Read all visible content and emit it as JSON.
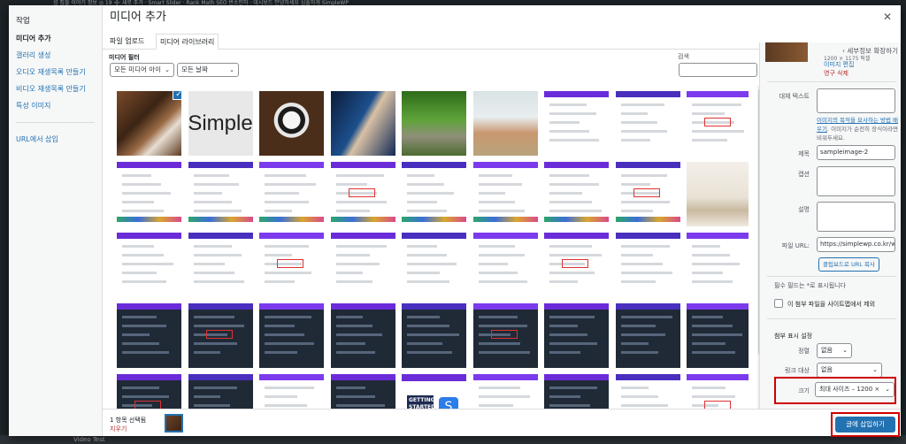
{
  "topbar": {
    "text": "섬 집들 이야기 정보  ◎  19  ➕  새로 추가  ·  Smart Slider  ·  Rank Math SEO 반소인하 ·  대시보드  안녕하세요 심플하게 SimpleWP"
  },
  "background": {
    "bottom_text": "Video Test"
  },
  "menu": {
    "heading": "작업",
    "items": [
      {
        "label": "미디어 추가",
        "active": true
      },
      {
        "label": "갤러리 생성"
      },
      {
        "label": "오디오 재생목록 만들기"
      },
      {
        "label": "비디오 재생목록 만들기"
      },
      {
        "label": "특성 이미지"
      }
    ],
    "url_insert": "URL에서 삽입"
  },
  "modal": {
    "title": "미디어 추가",
    "close_icon": "✕"
  },
  "tabs": [
    {
      "label": "파일 업로드"
    },
    {
      "label": "미디어 라이브러리",
      "active": true
    }
  ],
  "toolbar": {
    "filter_label": "미디어 필터",
    "type_filter": "모든 미디어 아이",
    "date_filter": "모든 날짜",
    "search_label": "검색",
    "search_value": ""
  },
  "grid": {
    "items": [
      "photo",
      "text",
      "photo",
      "photo",
      "photo",
      "photo",
      "screenshot",
      "screenshot",
      "screenshot",
      "screenshot",
      "screenshot",
      "screenshot",
      "screenshot",
      "screenshot",
      "screenshot",
      "screenshot",
      "screenshot",
      "photo",
      "screenshot",
      "screenshot",
      "screenshot",
      "screenshot",
      "screenshot",
      "screenshot",
      "screenshot",
      "screenshot",
      "screenshot",
      "screenshot",
      "screenshot",
      "screenshot",
      "screenshot",
      "screenshot",
      "screenshot",
      "screenshot",
      "screenshot",
      "screenshot",
      "screenshot",
      "screenshot",
      "screenshot",
      "screenshot",
      "screenshot",
      "screenshot",
      "screenshot",
      "screenshot",
      "screenshot"
    ],
    "thumb_text_simple": "Simple",
    "thumb_text_started": "GETTING STARTED",
    "selected_index": 0
  },
  "details": {
    "expand_label": "세부정보 확장하기",
    "dimensions": "1200 × 1175 픽셀",
    "edit_link": "이미지 편집",
    "delete_link": "영구 삭제",
    "alt_label": "대체 텍스트",
    "alt_help_link": "이미지의 목적을 묘사하는 방법 배우기",
    "alt_help_rest": ". 이미지가 순전히 장식이라면 비워두세요.",
    "title_label": "제목",
    "title_value": "sampleimage-2",
    "caption_label": "캡션",
    "description_label": "설명",
    "file_url_label": "파일 URL:",
    "file_url_value": "https://simplewp.co.kr/wp",
    "copy_url_button": "클립보드로 URL 복사",
    "required_note": "필수 필드는 *로 표시됩니다",
    "exclude_sitemap_label": "이 첨부 파일을 사이트맵에서 제외",
    "display_settings_title": "첨부 표시 설정",
    "align_label": "정렬",
    "align_value": "없음",
    "link_label": "링크 대상",
    "link_value": "없음",
    "size_label": "크기",
    "size_value": "최대 사이즈 – 1200 ×"
  },
  "footer": {
    "selected_count": "1 항목 선택됨",
    "clear_link": "지우기",
    "insert_button": "글에 삽입하기"
  },
  "colors": {
    "accent": "#2271b1",
    "highlight": "#cc0000",
    "danger": "#b32d2e"
  }
}
